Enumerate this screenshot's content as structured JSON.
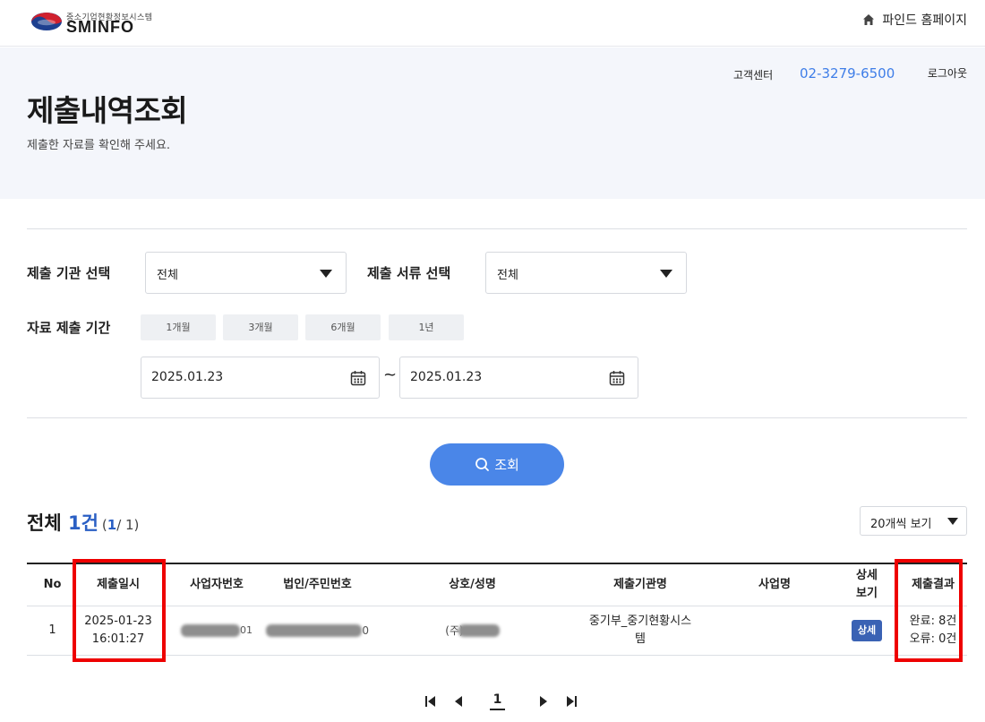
{
  "brand": {
    "logo_sub": "중소기업현황정보시스템",
    "logo_main": "SMINFO",
    "home_link": "파인드 홈페이지"
  },
  "header": {
    "cs_label": "고객센터",
    "cs_phone": "02-3279-6500",
    "logout": "로그아웃",
    "title": "제출내역조회",
    "description": "제출한 자료를 확인해 주세요."
  },
  "filters": {
    "agency_label": "제출 기관 선택",
    "agency_value": "전체",
    "doc_label": "제출 서류 선택",
    "doc_value": "전체",
    "period_label": "자료 제출 기간",
    "period_buttons": [
      "1개월",
      "3개월",
      "6개월",
      "1년"
    ],
    "date_from": "2025.01.23",
    "date_sep": "~",
    "date_to": "2025.01.23",
    "search_label": "조회"
  },
  "results": {
    "total_prefix": "전체 ",
    "total_count": "1건",
    "page_current": "1",
    "page_rest": "/ 1)",
    "page_open": "(",
    "per_page": "20개씩 보기"
  },
  "table": {
    "headers": {
      "no": "No",
      "date": "제출일시",
      "biz_no": "사업자번호",
      "corp_no": "법인/주민번호",
      "name": "상호/성명",
      "agency": "제출기관명",
      "biz_name": "사업명",
      "detail": "상세\n보기",
      "result": "제출결과"
    },
    "rows": [
      {
        "no": "1",
        "date_line1": "2025-01-23",
        "date_line2": "16:01:27",
        "biz_no_visible": "01",
        "corp_no_visible": "0",
        "name_visible": "(주)",
        "agency_line1": "중기부_중기현황시스",
        "agency_line2": "템",
        "biz_name": "",
        "detail_button": "상세",
        "result_line1": "완료: 8건",
        "result_line2": "오류: 0건"
      }
    ]
  },
  "pagination": {
    "current": "1"
  },
  "colors": {
    "accent": "#4a86e8",
    "phone": "#3f7ee8",
    "highlight": "#ee0000",
    "detail_button": "#3a62b4"
  }
}
